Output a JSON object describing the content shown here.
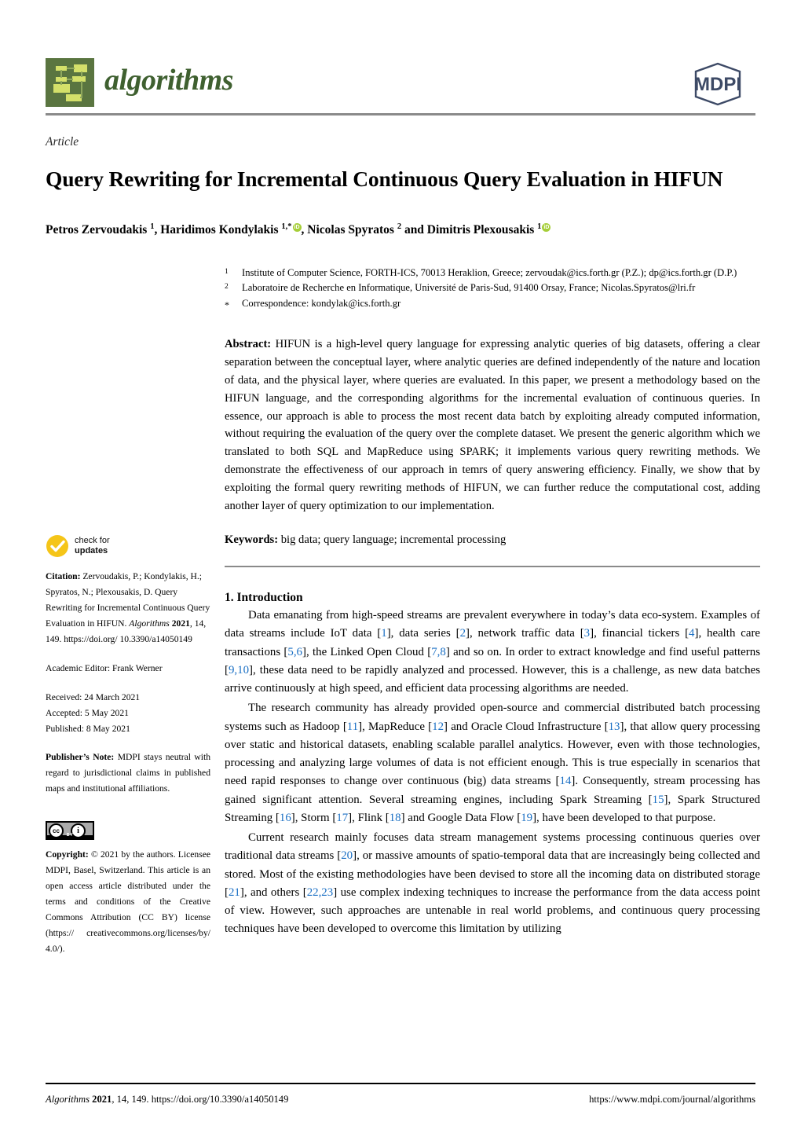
{
  "header": {
    "journal_name": "algorithms",
    "publisher_logo_text": "MDPI"
  },
  "title_block": {
    "article_kind": "Article",
    "title": "Query Rewriting for Incremental Continuous Query Evaluation in HIFUN",
    "authors_line_1": "Petros Zervoudakis ",
    "authors_sup_1": "1",
    "authors_line_2": ", Haridimos Kondylakis ",
    "authors_sup_2": "1,*",
    "orcid_glyph": "iD",
    "authors_line_3": ", Nicolas Spyratos ",
    "authors_sup_3": "2",
    "authors_line_4": " and Dimitris Plexousakis ",
    "authors_sup_4": "1"
  },
  "affiliations": [
    {
      "mark": "1",
      "text": "Institute of Computer Science, FORTH-ICS, 70013 Heraklion, Greece; zervoudak@ics.forth.gr (P.Z.); dp@ics.forth.gr (D.P.)"
    },
    {
      "mark": "2",
      "text": "Laboratoire de Recherche en Informatique, Université de Paris-Sud, 91400 Orsay, France; Nicolas.Spyratos@lri.fr"
    },
    {
      "mark": "*",
      "text": "Correspondence: kondylak@ics.forth.gr"
    }
  ],
  "abstract": {
    "label": "Abstract:",
    "text": " HIFUN is a high-level query language for expressing analytic queries of big datasets, offering a clear separation between the conceptual layer, where analytic queries are defined independently of the nature and location of data, and the physical layer, where queries are evaluated. In this paper, we present a methodology based on the HIFUN language, and the corresponding algorithms for the incremental evaluation of continuous queries. In essence, our approach is able to process the most recent data batch by exploiting already computed information, without requiring the evaluation of the query over the complete dataset. We present the generic algorithm which we translated to both SQL and MapReduce using SPARK; it implements various query rewriting methods. We demonstrate the effectiveness of our approach in temrs of query answering efficiency. Finally, we show that by exploiting the formal query rewriting methods of HIFUN, we can further reduce the computational cost, adding another layer of query optimization to our implementation."
  },
  "keywords": {
    "label": "Keywords:",
    "text": " big data; query language; incremental processing"
  },
  "section": {
    "heading": "1. Introduction",
    "paragraphs": [
      [
        {
          "t": "Data emanating from high-speed streams are prevalent everywhere in today’s data eco-system. Examples of data streams include IoT data ["
        },
        {
          "r": "1"
        },
        {
          "t": "], data series ["
        },
        {
          "r": "2"
        },
        {
          "t": "], network traffic data ["
        },
        {
          "r": "3"
        },
        {
          "t": "], financial tickers ["
        },
        {
          "r": "4"
        },
        {
          "t": "], health care transactions ["
        },
        {
          "r": "5,6"
        },
        {
          "t": "], the Linked Open Cloud ["
        },
        {
          "r": "7,8"
        },
        {
          "t": "] and so on. In order to extract knowledge and find useful patterns ["
        },
        {
          "r": "9,10"
        },
        {
          "t": "], these data need to be rapidly analyzed and processed. However, this is a challenge, as new data batches arrive continuously at high speed, and efficient data processing algorithms are needed."
        }
      ],
      [
        {
          "t": "The research community has already provided open-source and commercial distributed batch processing systems such as Hadoop ["
        },
        {
          "r": "11"
        },
        {
          "t": "], MapReduce ["
        },
        {
          "r": "12"
        },
        {
          "t": "] and Oracle Cloud Infrastructure ["
        },
        {
          "r": "13"
        },
        {
          "t": "], that allow query processing over static and historical datasets, enabling scalable parallel analytics. However, even with those technologies, processing and analyzing large volumes of data is not efficient enough. This is true especially in scenarios that need rapid responses to change over continuous (big) data streams ["
        },
        {
          "r": "14"
        },
        {
          "t": "]. Consequently, stream processing has gained significant attention. Several streaming engines, including Spark Streaming ["
        },
        {
          "r": "15"
        },
        {
          "t": "], Spark Structured Streaming ["
        },
        {
          "r": "16"
        },
        {
          "t": "], Storm ["
        },
        {
          "r": "17"
        },
        {
          "t": "], Flink ["
        },
        {
          "r": "18"
        },
        {
          "t": "] and Google Data Flow ["
        },
        {
          "r": "19"
        },
        {
          "t": "], have been developed to that purpose."
        }
      ],
      [
        {
          "t": "Current research mainly focuses data stream management systems processing continuous queries over traditional data streams ["
        },
        {
          "r": "20"
        },
        {
          "t": "], or massive amounts of spatio-temporal data that are increasingly being collected and stored. Most of the existing methodologies have been devised to store all the incoming data on distributed storage ["
        },
        {
          "r": "21"
        },
        {
          "t": "], and others ["
        },
        {
          "r": "22,23"
        },
        {
          "t": "] use complex indexing techniques to increase the performance from the data access point of view. However, such approaches are untenable in real world problems, and continuous query processing techniques have been developed to overcome this limitation by utilizing"
        }
      ]
    ]
  },
  "sidebar": {
    "check_for_updates": {
      "line1": "check for",
      "line2": "updates"
    },
    "citation_label": "Citation:",
    "citation_part1": "  Zervoudakis, P.; Kondylakis, H.; Spyratos, N.; Plexousakis, D. Query Rewriting for Incremental Continuous Query Evaluation in HIFUN. ",
    "citation_journal": "Algorithms",
    "citation_year": "2021",
    "citation_part2": ", 14, 149.  https://doi.org/ 10.3390/a14050149",
    "academic_editor": "Academic Editor: Frank Werner",
    "received": "Received: 24 March 2021",
    "accepted": "Accepted: 5 May 2021",
    "published": "Published: 8 May 2021",
    "publishers_note_label": "Publisher’s Note:",
    "publishers_note_text": " MDPI stays neutral with regard to jurisdictional claims in published maps and institutional affiliations.",
    "cc_badge": {
      "cc": "cc",
      "info": "i",
      "by": "BY"
    },
    "copyright_label": "Copyright:",
    "copyright_text": " © 2021 by the authors. Licensee MDPI, Basel, Switzerland. This article is an open access article distributed under the terms and conditions of the Creative Commons Attribution (CC BY) license (https:// creativecommons.org/licenses/by/ 4.0/)."
  },
  "footer": {
    "left_journal": "Algorithms",
    "left_year": "2021",
    "left_rest": ", 14, 149. https://doi.org/10.3390/a14050149",
    "right": "https://www.mdpi.com/journal/algorithms"
  },
  "colors": {
    "journal_green": "#3f6030",
    "logo_bg": "#5a7540",
    "logo_box": "#d4e06a",
    "mdpi_navy": "#3d4a66",
    "reference_blue": "#1a6fc4",
    "check_yellow": "#f5c518",
    "orcid_green": "#a6ce39",
    "rule_gray": "#8a8a8a"
  }
}
